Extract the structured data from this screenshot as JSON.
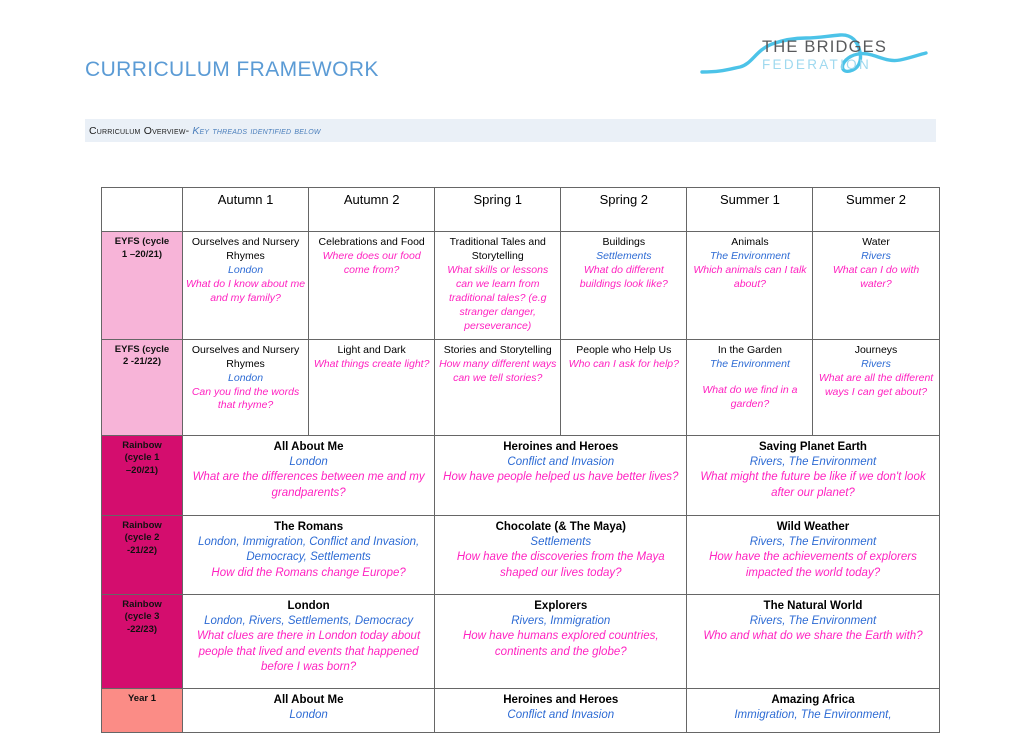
{
  "header": {
    "title": "CURRICULUM FRAMEWORK",
    "logo": {
      "name": "the-bridges-federation-logo",
      "line1": "THE BRIDGES",
      "line2": "FEDERATION"
    }
  },
  "banner": {
    "label": "Curriculum Overview-",
    "subtitle": "Key threads identified below"
  },
  "table": {
    "columns": [
      "",
      "Autumn 1",
      "Autumn 2",
      "Spring 1",
      "Spring 2",
      "Summer 1",
      "Summer 2"
    ],
    "rows": [
      {
        "id": "eyfs-cycle-1",
        "label_line1": "EYFS  (cycle",
        "label_line2": "1 –20/21)",
        "label_style": "eyfs",
        "span": 1,
        "cells": [
          {
            "topic": "Ourselves and Nursery Rhymes",
            "thread": "London",
            "question": "What do I know about me and my family?"
          },
          {
            "topic": "Celebrations and Food",
            "thread": "",
            "question": "Where does our food come from?"
          },
          {
            "topic": "Traditional Tales and Storytelling",
            "thread": "",
            "question": "What skills or lessons can we learn from traditional tales? (e.g stranger danger, perseverance)"
          },
          {
            "topic": "Buildings",
            "thread": "Settlements",
            "question": "What do different buildings look like?"
          },
          {
            "topic": "Animals",
            "thread": "The Environment",
            "question": "Which animals can I talk about?"
          },
          {
            "topic": "Water",
            "thread": "Rivers",
            "question": "What can I do with water?"
          }
        ]
      },
      {
        "id": "eyfs-cycle-2",
        "label_line1": "EYFS (cycle",
        "label_line2": "2 -21/22)",
        "label_style": "eyfs",
        "span": 1,
        "cells": [
          {
            "topic": "Ourselves and Nursery Rhymes",
            "thread": "London",
            "question": "Can you find the words that rhyme?"
          },
          {
            "topic": "Light and Dark",
            "thread": "",
            "question": "What things create light?"
          },
          {
            "topic": "Stories and Storytelling",
            "thread": "",
            "question": "How many different ways can we tell stories?"
          },
          {
            "topic": "People who Help Us",
            "thread": "",
            "question": "Who can I ask for help?"
          },
          {
            "topic": "In the Garden",
            "thread": "The Environment",
            "question": "What do we find in a garden?",
            "gap": true
          },
          {
            "topic": "Journeys",
            "thread": "Rivers",
            "question": "What are all the different ways  I can get about?"
          }
        ]
      },
      {
        "id": "rainbow-cycle-1",
        "label_line1": "Rainbow",
        "label_line2": "(cycle 1",
        "label_line3": "–20/21)",
        "label_style": "rainbow",
        "span": 2,
        "cells": [
          {
            "topic": "All About Me",
            "thread": "London",
            "question": "What are the differences between me and my grandparents?"
          },
          {
            "topic": "Heroines and Heroes",
            "thread": "Conflict and Invasion",
            "question": "How have people helped us have better lives?"
          },
          {
            "topic": "Saving Planet Earth",
            "thread": "Rivers, The Environment",
            "question": "What might the future be like if we don't look after our planet?"
          }
        ]
      },
      {
        "id": "rainbow-cycle-2",
        "label_line1": "Rainbow",
        "label_line2": "(cycle 2",
        "label_line3": "-21/22)",
        "label_style": "rainbow",
        "span": 2,
        "cells": [
          {
            "topic": "The Romans",
            "thread": "London, Immigration, Conflict and Invasion, Democracy, Settlements",
            "question": "How did the Romans change Europe?"
          },
          {
            "topic": "Chocolate (& The Maya)",
            "thread": "Settlements",
            "question": "How have the discoveries from the Maya shaped our lives today?"
          },
          {
            "topic": "Wild Weather",
            "thread": "Rivers, The Environment",
            "question": "How have the achievements of explorers impacted the world today?"
          }
        ]
      },
      {
        "id": "rainbow-cycle-3",
        "label_line1": "Rainbow",
        "label_line2": "(cycle 3",
        "label_line3": "-22/23)",
        "label_style": "rainbow",
        "span": 2,
        "cells": [
          {
            "topic": "London",
            "thread": "London, Rivers, Settlements, Democracy",
            "question": "What clues are there in London today about people that lived and events that happened before I was born?"
          },
          {
            "topic": "Explorers",
            "thread": "Rivers, Immigration",
            "question": "How have humans explored countries, continents and the globe?"
          },
          {
            "topic": "The Natural World",
            "thread": "Rivers, The Environment",
            "question": "Who and what do we share the Earth with?"
          }
        ]
      },
      {
        "id": "year-1",
        "label_line1": "Year 1",
        "label_style": "year",
        "span": 2,
        "cells": [
          {
            "topic": "All About Me",
            "thread": "London",
            "question": ""
          },
          {
            "topic": "Heroines and Heroes",
            "thread": "Conflict and Invasion",
            "question": ""
          },
          {
            "topic": "Amazing Africa",
            "thread": "Immigration, The Environment,",
            "question": ""
          }
        ]
      }
    ]
  },
  "colors": {
    "title_blue": "#5b9bd5",
    "banner_bg": "#eaf0f7",
    "thread_blue": "#2d6bd4",
    "question_magenta": "#ff22c0",
    "eyfs_pink": "#f7b4d8",
    "rainbow_magenta": "#d40d6e",
    "year_salmon": "#fb8c86",
    "logo_grey": "#58595b",
    "logo_lightblue": "#9fd9ef"
  }
}
